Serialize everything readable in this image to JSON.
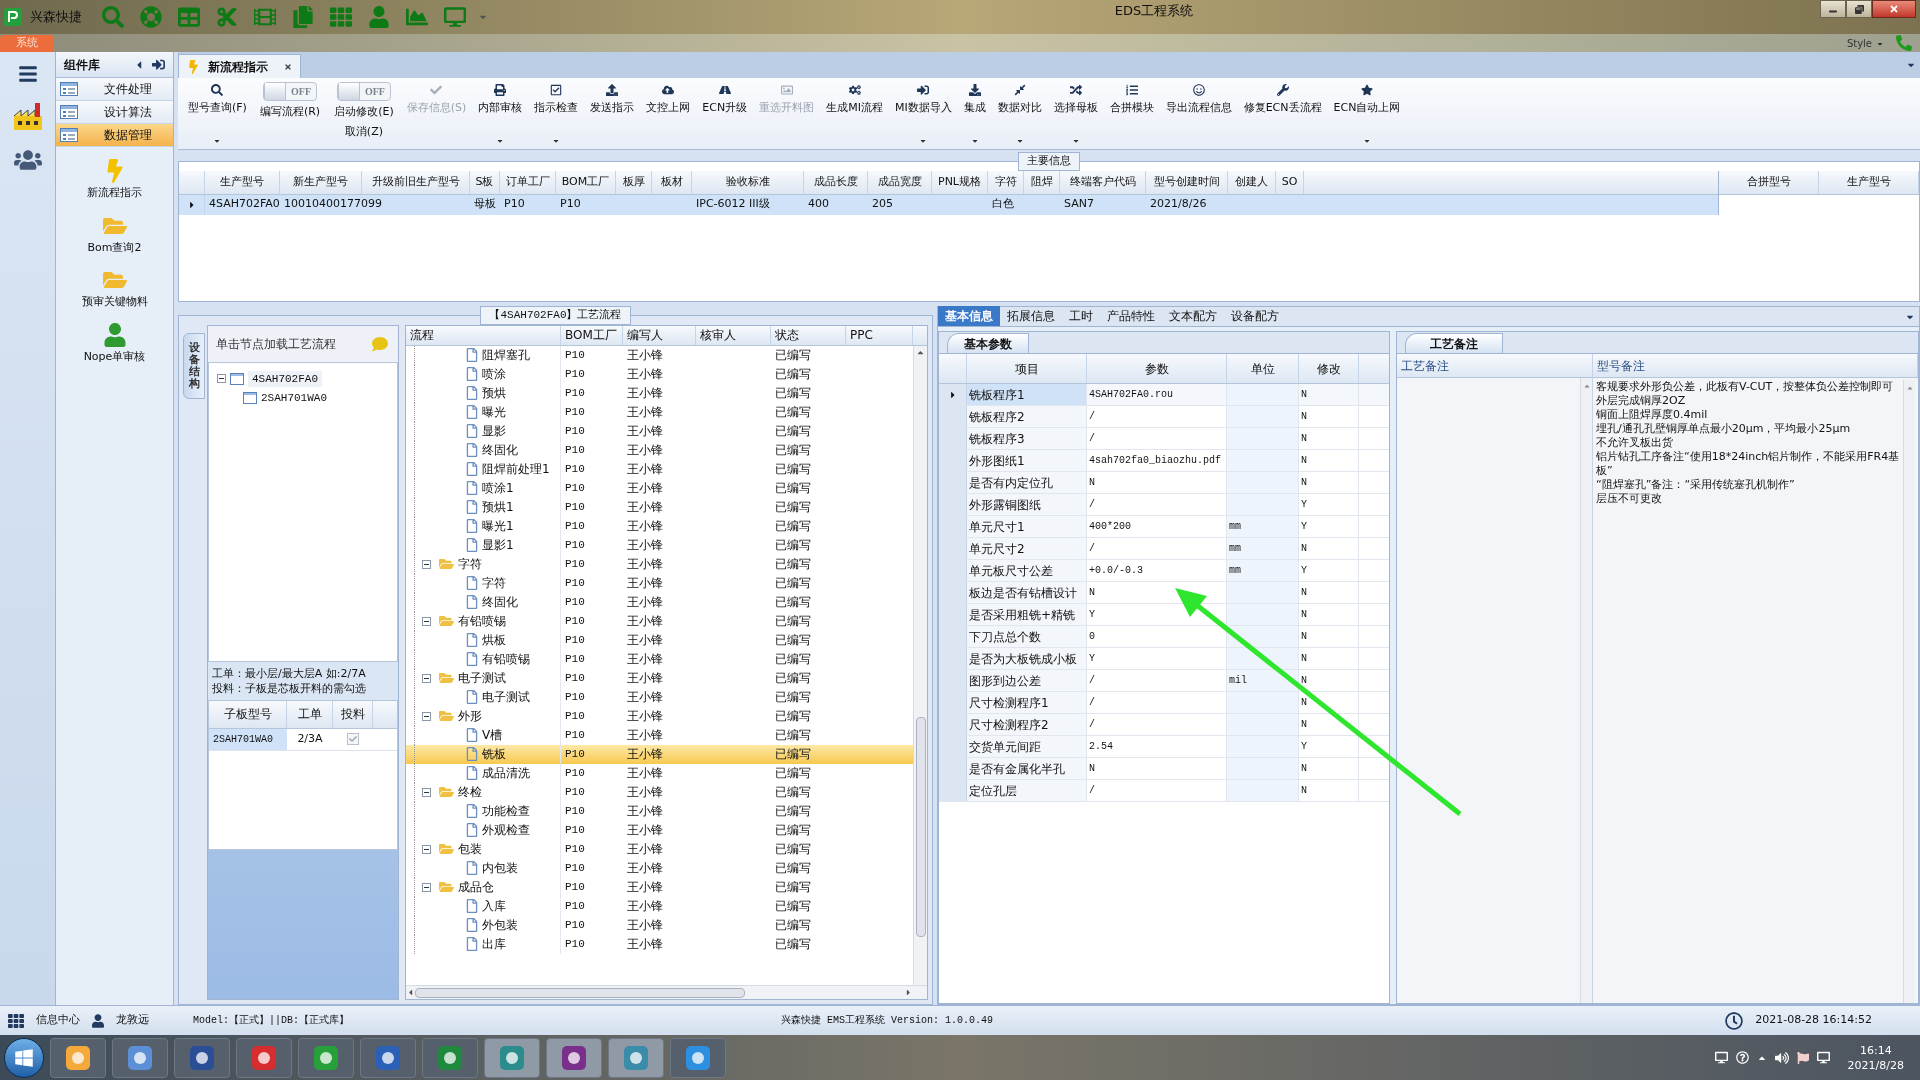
{
  "title_bar": {
    "app_name": "兴森快捷",
    "title": "EDS工程系统"
  },
  "ribbon": {
    "tabs": [
      {
        "label": "系统",
        "selected": true
      }
    ],
    "style_menu": "Style"
  },
  "nav": {
    "title": "组件库",
    "items": [
      {
        "label": "文件处理",
        "selected": false
      },
      {
        "label": "设计算法",
        "selected": false
      },
      {
        "label": "数据管理",
        "selected": true
      }
    ],
    "tiles": [
      {
        "label": "新流程指示"
      },
      {
        "label": "Bom查询2"
      },
      {
        "label": "预审关键物料"
      },
      {
        "label": "Nope单审核"
      }
    ]
  },
  "doc_tabs": [
    {
      "label": "新流程指示",
      "selected": true
    }
  ],
  "toolbar": [
    {
      "kind": "button",
      "label": "型号查询(F)",
      "disabled": false,
      "dropdown": true
    },
    {
      "kind": "toggle",
      "label": "编写流程(R)",
      "toggle_text": "OFF",
      "on": false
    },
    {
      "kind": "toggle",
      "label": "启动修改(E)",
      "sublabel": "取消(Z)",
      "toggle_text": "OFF",
      "on": false
    },
    {
      "kind": "button",
      "label": "保存信息(S)",
      "disabled": true,
      "dropdown": false
    },
    {
      "kind": "button",
      "label": "内部审核",
      "disabled": false,
      "dropdown": true
    },
    {
      "kind": "button",
      "label": "指示检查",
      "disabled": false,
      "dropdown": true
    },
    {
      "kind": "button",
      "label": "发送指示",
      "disabled": false,
      "dropdown": false
    },
    {
      "kind": "button",
      "label": "文控上网",
      "disabled": false,
      "dropdown": false
    },
    {
      "kind": "button",
      "label": "ECN升级",
      "disabled": false,
      "dropdown": false
    },
    {
      "kind": "button",
      "label": "重选开料图",
      "disabled": true,
      "dropdown": false
    },
    {
      "kind": "button",
      "label": "生成MI流程",
      "disabled": false,
      "dropdown": false
    },
    {
      "kind": "button",
      "label": "MI数据导入",
      "disabled": false,
      "dropdown": true
    },
    {
      "kind": "button",
      "label": "集成",
      "disabled": false,
      "dropdown": true
    },
    {
      "kind": "button",
      "label": "数据对比",
      "disabled": false,
      "dropdown": true
    },
    {
      "kind": "button",
      "label": "选择母板",
      "disabled": false,
      "dropdown": true
    },
    {
      "kind": "button",
      "label": "合拼模块",
      "disabled": false,
      "dropdown": false
    },
    {
      "kind": "button",
      "label": "导出流程信息",
      "disabled": false,
      "dropdown": false
    },
    {
      "kind": "button",
      "label": "修复ECN丢流程",
      "disabled": false,
      "dropdown": false
    },
    {
      "kind": "button",
      "label": "ECN自动上网",
      "disabled": false,
      "dropdown": true
    }
  ],
  "main_info": {
    "title": "主要信息",
    "columns": [
      "生产型号",
      "新生产型号",
      "升级前旧生产型号",
      "S板",
      "订单工厂",
      "BOM工厂",
      "板厚",
      "板材",
      "验收标准",
      "成品长度",
      "成品宽度",
      "PNL规格",
      "字符",
      "阻焊",
      "终端客户代码",
      "型号创建时间",
      "创建人",
      "SO"
    ],
    "rows": [
      {
        "selected": true,
        "cells": [
          "4SAH702FA0",
          "10010400177099",
          null,
          "母板",
          "P10",
          "P10",
          null,
          null,
          "IPC-6012 III级",
          "400",
          "205",
          null,
          "白色",
          null,
          "SAN7",
          "2021/8/26",
          null,
          null
        ]
      }
    ],
    "side_columns": [
      "合拼型号",
      "生产型号"
    ]
  },
  "process": {
    "title": "【4SAH702FA0】工艺流程",
    "side_tab": "设备结构",
    "hint": "单击节点加载工艺流程",
    "structure": [
      {
        "label": "4SAH702FA0",
        "expanded": true,
        "children": [
          {
            "label": "2SAH701WA0"
          }
        ]
      }
    ],
    "note": [
      "工单：最小层/最大层A 如:2/7A",
      "投料：子板是芯板开料的需勾选"
    ],
    "sub_table": {
      "columns": [
        "子板型号",
        "工单",
        "投料"
      ],
      "rows": [
        {
          "model": "2SAH701WA0",
          "order": "2/3A",
          "checked": true
        }
      ]
    },
    "columns": [
      "流程",
      "BOM工厂",
      "编写人",
      "核审人",
      "状态",
      "PPC"
    ],
    "tree": [
      {
        "kind": "scrolled-parent",
        "children": [
          {
            "kind": "file",
            "label": "阻焊塞孔",
            "bom": "P10",
            "writer": "王小锋",
            "status": "已编写",
            "selected": false
          },
          {
            "kind": "file",
            "label": "喷涂",
            "bom": "P10",
            "writer": "王小锋",
            "status": "已编写",
            "selected": false
          },
          {
            "kind": "file",
            "label": "预烘",
            "bom": "P10",
            "writer": "王小锋",
            "status": "已编写",
            "selected": false
          },
          {
            "kind": "file",
            "label": "曝光",
            "bom": "P10",
            "writer": "王小锋",
            "status": "已编写",
            "selected": false
          },
          {
            "kind": "file",
            "label": "显影",
            "bom": "P10",
            "writer": "王小锋",
            "status": "已编写",
            "selected": false
          },
          {
            "kind": "file",
            "label": "终固化",
            "bom": "P10",
            "writer": "王小锋",
            "status": "已编写",
            "selected": false
          },
          {
            "kind": "file",
            "label": "阻焊前处理1",
            "bom": "P10",
            "writer": "王小锋",
            "status": "已编写",
            "selected": false
          },
          {
            "kind": "file",
            "label": "喷涂1",
            "bom": "P10",
            "writer": "王小锋",
            "status": "已编写",
            "selected": false
          },
          {
            "kind": "file",
            "label": "预烘1",
            "bom": "P10",
            "writer": "王小锋",
            "status": "已编写",
            "selected": false
          },
          {
            "kind": "file",
            "label": "曝光1",
            "bom": "P10",
            "writer": "王小锋",
            "status": "已编写",
            "selected": false
          },
          {
            "kind": "file",
            "label": "显影1",
            "bom": "P10",
            "writer": "王小锋",
            "status": "已编写",
            "selected": false
          }
        ]
      },
      {
        "kind": "folder",
        "label": "字符",
        "bom": "P10",
        "writer": "王小锋",
        "status": "已编写",
        "selected": false,
        "expanded": true,
        "children": [
          {
            "kind": "file",
            "label": "字符",
            "bom": "P10",
            "writer": "王小锋",
            "status": "已编写",
            "selected": false
          },
          {
            "kind": "file",
            "label": "终固化",
            "bom": "P10",
            "writer": "王小锋",
            "status": "已编写",
            "selected": false
          }
        ]
      },
      {
        "kind": "folder",
        "label": "有铅喷锡",
        "bom": "P10",
        "writer": "王小锋",
        "status": "已编写",
        "selected": false,
        "expanded": true,
        "children": [
          {
            "kind": "file",
            "label": "烘板",
            "bom": "P10",
            "writer": "王小锋",
            "status": "已编写",
            "selected": false
          },
          {
            "kind": "file",
            "label": "有铅喷锡",
            "bom": "P10",
            "writer": "王小锋",
            "status": "已编写",
            "selected": false
          }
        ]
      },
      {
        "kind": "folder",
        "label": "电子测试",
        "bom": "P10",
        "writer": "王小锋",
        "status": "已编写",
        "selected": false,
        "expanded": true,
        "children": [
          {
            "kind": "file",
            "label": "电子测试",
            "bom": "P10",
            "writer": "王小锋",
            "status": "已编写",
            "selected": false
          }
        ]
      },
      {
        "kind": "folder",
        "label": "外形",
        "bom": "P10",
        "writer": "王小锋",
        "status": "已编写",
        "selected": false,
        "expanded": true,
        "children": [
          {
            "kind": "file",
            "label": "V槽",
            "bom": "P10",
            "writer": "王小锋",
            "status": "已编写",
            "selected": false
          },
          {
            "kind": "file",
            "label": "铣板",
            "bom": "P10",
            "writer": "王小锋",
            "status": "已编写",
            "selected": true
          },
          {
            "kind": "file",
            "label": "成品清洗",
            "bom": "P10",
            "writer": "王小锋",
            "status": "已编写",
            "selected": false
          }
        ]
      },
      {
        "kind": "folder",
        "label": "终检",
        "bom": "P10",
        "writer": "王小锋",
        "status": "已编写",
        "selected": false,
        "expanded": true,
        "children": [
          {
            "kind": "file",
            "label": "功能检查",
            "bom": "P10",
            "writer": "王小锋",
            "status": "已编写",
            "selected": false
          },
          {
            "kind": "file",
            "label": "外观检查",
            "bom": "P10",
            "writer": "王小锋",
            "status": "已编写",
            "selected": false
          }
        ]
      },
      {
        "kind": "folder",
        "label": "包装",
        "bom": "P10",
        "writer": "王小锋",
        "status": "已编写",
        "selected": false,
        "expanded": true,
        "children": [
          {
            "kind": "file",
            "label": "内包装",
            "bom": "P10",
            "writer": "王小锋",
            "status": "已编写",
            "selected": false
          }
        ]
      },
      {
        "kind": "folder",
        "label": "成品仓",
        "bom": "P10",
        "writer": "王小锋",
        "status": "已编写",
        "selected": false,
        "expanded": true,
        "children": [
          {
            "kind": "file",
            "label": "入库",
            "bom": "P10",
            "writer": "王小锋",
            "status": "已编写",
            "selected": false
          },
          {
            "kind": "file",
            "label": "外包装",
            "bom": "P10",
            "writer": "王小锋",
            "status": "已编写",
            "selected": false
          },
          {
            "kind": "file",
            "label": "出库",
            "bom": "P10",
            "writer": "王小锋",
            "status": "已编写",
            "selected": false
          }
        ]
      }
    ]
  },
  "detail": {
    "tabs": [
      {
        "label": "基本信息",
        "selected": true
      },
      {
        "label": "拓展信息",
        "selected": false
      },
      {
        "label": "工时",
        "selected": false
      },
      {
        "label": "产品特性",
        "selected": false
      },
      {
        "label": "文本配方",
        "selected": false
      },
      {
        "label": "设备配方",
        "selected": false
      }
    ],
    "sub_tab": "基本参数",
    "columns": [
      "项目",
      "参数",
      "单位",
      "修改"
    ],
    "rows": [
      {
        "item": "铣板程序1",
        "value": "4SAH702FA0.rou",
        "modified": "N",
        "selected": true
      },
      {
        "item": "铣板程序2",
        "value": "/",
        "modified": "N",
        "selected": false
      },
      {
        "item": "铣板程序3",
        "value": "/",
        "modified": "N",
        "selected": false
      },
      {
        "item": "外形图纸1",
        "value": "4sah702fa0_biaozhu.pdf",
        "modified": "N",
        "selected": false
      },
      {
        "item": "是否有内定位孔",
        "value": "N",
        "modified": "N",
        "selected": false
      },
      {
        "item": "外形露铜图纸",
        "value": "/",
        "modified": "Y",
        "selected": false
      },
      {
        "item": "单元尺寸1",
        "value": "400*200",
        "unit": "mm",
        "modified": "Y",
        "selected": false
      },
      {
        "item": "单元尺寸2",
        "value": "/",
        "unit": "mm",
        "modified": "N",
        "selected": false
      },
      {
        "item": "单元板尺寸公差",
        "value": "+0.0/-0.3",
        "unit": "mm",
        "modified": "Y",
        "selected": false
      },
      {
        "item": "板边是否有钻槽设计",
        "value": "N",
        "modified": "N",
        "selected": false
      },
      {
        "item": "是否采用粗铣+精铣",
        "value": "Y",
        "modified": "N",
        "selected": false
      },
      {
        "item": "下刀点总个数",
        "value": "0",
        "modified": "N",
        "selected": false
      },
      {
        "item": "是否为大板铣成小板",
        "value": "Y",
        "modified": "N",
        "selected": false
      },
      {
        "item": "图形到边公差",
        "value": "/",
        "unit": "mil",
        "modified": "N",
        "selected": false
      },
      {
        "item": "尺寸检测程序1",
        "value": "/",
        "modified": "N",
        "selected": false
      },
      {
        "item": "尺寸检测程序2",
        "value": "/",
        "modified": "N",
        "selected": false
      },
      {
        "item": "交货单元间距",
        "value": "2.54",
        "modified": "Y",
        "selected": false
      },
      {
        "item": "是否有金属化半孔",
        "value": "N",
        "modified": "N",
        "selected": false
      },
      {
        "item": "定位孔层",
        "value": "/",
        "modified": "N",
        "selected": false
      }
    ]
  },
  "notes": {
    "tab": "工艺备注",
    "columns": [
      "工艺备注",
      "型号备注"
    ],
    "model_note": [
      "客规要求外形负公差，此板有V-CUT，按整体负公差控制即可",
      "外层完成铜厚2OZ",
      "铜面上阻焊厚度0.4mil",
      "埋孔/通孔孔壁铜厚单点最小20μm，平均最小25μm",
      "不允许叉板出货",
      "铝片钻孔工序备注“使用18*24inch铝片制作，不能采用FR4基板”",
      "“阻焊塞孔”备注：“采用传统塞孔机制作”",
      "层压不可更改"
    ]
  },
  "status_bar": {
    "info_center": "信息中心",
    "user": "龙敦远",
    "model_db": "Model:【正式】||DB:【正式库】",
    "version": "兴森快捷 EMS工程系统 Version: 1.0.0.49",
    "datetime": "2021-08-28 16:14:52"
  },
  "taskbar": {
    "time": "16:14",
    "date": "2021/8/28"
  }
}
